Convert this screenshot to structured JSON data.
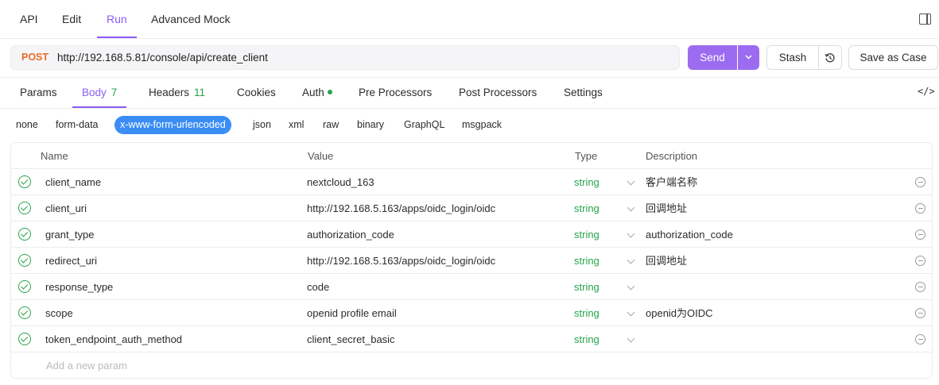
{
  "top_tabs": [
    "API",
    "Edit",
    "Run",
    "Advanced Mock"
  ],
  "request": {
    "method": "POST",
    "url": "http://192.168.5.81/console/api/create_client"
  },
  "actions": {
    "send": "Send",
    "stash": "Stash",
    "save_case": "Save as Case"
  },
  "sub_tabs": {
    "params": "Params",
    "body": "Body",
    "body_count": "7",
    "headers": "Headers",
    "headers_count": "11",
    "cookies": "Cookies",
    "auth": "Auth",
    "pre": "Pre Processors",
    "post": "Post Processors",
    "settings": "Settings"
  },
  "code_toggle": "</>",
  "body_types": [
    "none",
    "form-data",
    "x-www-form-urlencoded",
    "json",
    "xml",
    "raw",
    "binary",
    "GraphQL",
    "msgpack"
  ],
  "columns": [
    "Name",
    "Value",
    "Type",
    "Description"
  ],
  "rows": [
    {
      "name": "client_name",
      "value": "nextcloud_163",
      "type": "string",
      "description": "客户端名称"
    },
    {
      "name": "client_uri",
      "value": "http://192.168.5.163/apps/oidc_login/oidc",
      "type": "string",
      "description": "回调地址"
    },
    {
      "name": "grant_type",
      "value": "authorization_code",
      "type": "string",
      "description": "authorization_code"
    },
    {
      "name": "redirect_uri",
      "value": "http://192.168.5.163/apps/oidc_login/oidc",
      "type": "string",
      "description": "回调地址"
    },
    {
      "name": "response_type",
      "value": "code",
      "type": "string",
      "description": ""
    },
    {
      "name": "scope",
      "value": "openid profile email",
      "type": "string",
      "description": "openid为OIDC"
    },
    {
      "name": "token_endpoint_auth_method",
      "value": "client_secret_basic",
      "type": "string",
      "description": ""
    }
  ],
  "add_param_placeholder": "Add a new param",
  "colors": {
    "accent": "#8b5cf6",
    "send_button": "#9b6cf0",
    "method_post": "#ee6a2a",
    "string_type": "#27a44b",
    "active_body_type": "#3a8df5"
  }
}
